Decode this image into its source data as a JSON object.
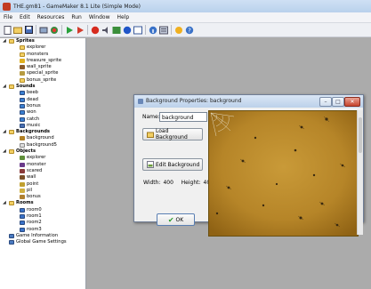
{
  "window": {
    "title": "THE.gm81 - GameMaker 8.1 Lite (Simple Mode)"
  },
  "menu": [
    "File",
    "Edit",
    "Resources",
    "Run",
    "Window",
    "Help"
  ],
  "toolbar": {
    "icons": [
      "new-file-icon",
      "open-icon",
      "save-icon",
      "create-executable-icon",
      "publish-icon",
      "run-icon",
      "debug-icon",
      "create-sprite-icon",
      "create-sound-icon",
      "create-background-icon",
      "create-object-icon",
      "create-room-icon",
      "game-information-icon",
      "global-settings-icon",
      "extension-icon",
      "help-icon"
    ]
  },
  "tree": {
    "nodes": [
      {
        "label": "Sprites",
        "cat": true,
        "level": 0,
        "icon": "folder",
        "exp": "-"
      },
      {
        "label": "explorer",
        "level": 1,
        "icon": "folder"
      },
      {
        "label": "monsters",
        "level": 1,
        "icon": "folder"
      },
      {
        "label": "treasure_sprite",
        "level": 1,
        "icon": "sprite",
        "color": "#e0b020"
      },
      {
        "label": "wall_sprite",
        "level": 1,
        "icon": "sprite",
        "color": "#8a5a2a"
      },
      {
        "label": "special_sprite",
        "level": 1,
        "icon": "sprite",
        "color": "#b69a40"
      },
      {
        "label": "bonus_sprite",
        "level": 1,
        "icon": "folder"
      },
      {
        "label": "Sounds",
        "cat": true,
        "level": 0,
        "icon": "folder",
        "exp": "-"
      },
      {
        "label": "beeb",
        "level": 1,
        "icon": "sound",
        "color": "#3a7fd0"
      },
      {
        "label": "dead",
        "level": 1,
        "icon": "sound",
        "color": "#3a7fd0"
      },
      {
        "label": "bonus",
        "level": 1,
        "icon": "sound",
        "color": "#3a7fd0"
      },
      {
        "label": "won",
        "level": 1,
        "icon": "sound",
        "color": "#3a7fd0"
      },
      {
        "label": "catch",
        "level": 1,
        "icon": "sound",
        "color": "#3a7fd0"
      },
      {
        "label": "music",
        "level": 1,
        "icon": "sound",
        "color": "#4a6fb0"
      },
      {
        "label": "Backgrounds",
        "cat": true,
        "level": 0,
        "icon": "folder",
        "exp": "-"
      },
      {
        "label": "background",
        "level": 1,
        "icon": "bg",
        "color": "#b08024"
      },
      {
        "label": "background5",
        "level": 1,
        "icon": "bg-empty",
        "color": "#dddddd"
      },
      {
        "label": "Objects",
        "cat": true,
        "level": 0,
        "icon": "folder",
        "exp": "-"
      },
      {
        "label": "explorer",
        "level": 1,
        "icon": "obj",
        "color": "#5f8f3a"
      },
      {
        "label": "monster",
        "level": 1,
        "icon": "obj",
        "color": "#6a3a8a"
      },
      {
        "label": "scared",
        "level": 1,
        "icon": "obj",
        "color": "#8a3a3a"
      },
      {
        "label": "wall",
        "level": 1,
        "icon": "obj",
        "color": "#7a5028"
      },
      {
        "label": "point",
        "level": 1,
        "icon": "obj",
        "color": "#c0a030"
      },
      {
        "label": "pil",
        "level": 1,
        "icon": "obj",
        "color": "#d0b040"
      },
      {
        "label": "bonus",
        "level": 1,
        "icon": "obj",
        "color": "#b08030"
      },
      {
        "label": "Rooms",
        "cat": true,
        "level": 0,
        "icon": "folder",
        "exp": "-"
      },
      {
        "label": "room0",
        "level": 1,
        "icon": "room",
        "color": "#3a72c8"
      },
      {
        "label": "room1",
        "level": 1,
        "icon": "room",
        "color": "#3a72c8"
      },
      {
        "label": "room2",
        "level": 1,
        "icon": "room",
        "color": "#3a72c8"
      },
      {
        "label": "room3",
        "level": 1,
        "icon": "room",
        "color": "#3a72c8"
      },
      {
        "label": "Game Information",
        "level": 0,
        "icon": "info",
        "color": "#4a7ac0"
      },
      {
        "label": "Global Game Settings",
        "level": 0,
        "icon": "settings",
        "color": "#4a7ac0"
      }
    ]
  },
  "dialog": {
    "title": "Background Properties: background",
    "name_label": "Name:",
    "name_value": "background",
    "load_label": "Load Background",
    "edit_label": "Edit Background",
    "width_label": "Width:",
    "width_value": "400",
    "height_label": "Height:",
    "height_value": "400",
    "ok_label": "OK"
  }
}
